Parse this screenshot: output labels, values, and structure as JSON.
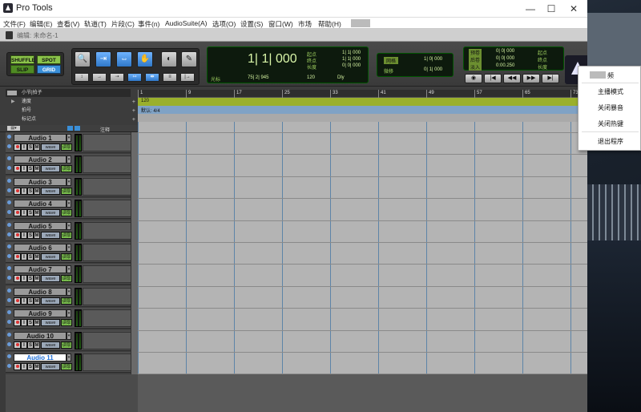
{
  "window": {
    "title": "Pro Tools",
    "minimize": "—",
    "maximize": "☐",
    "close": "✕"
  },
  "menu": [
    "文件(F)",
    "编辑(E)",
    "查看(V)",
    "轨道(T)",
    "片段(C)",
    "事件(n)",
    "AudioSuite(A)",
    "选项(O)",
    "设置(S)",
    "窗口(W)",
    "市场",
    "帮助(H)"
  ],
  "doc": {
    "title": "编辑: 未命名-1"
  },
  "modes": {
    "shuffle": "SHUFFLE",
    "spot": "SPOT",
    "slip": "SLIP",
    "grid": "GRID"
  },
  "counter": {
    "main": "1| 1| 000",
    "start_label": "起点",
    "end_label": "终点",
    "length_label": "长度",
    "start": "1| 1| 000",
    "end": "1| 1| 000",
    "length": "0| 0| 000",
    "cursor_label": "光标",
    "cursor": "75| 2| 945",
    "tempo": "120",
    "dly": "Dly"
  },
  "grid_panel": {
    "grid_label": "网格",
    "grid_val": "1| 0| 000",
    "nudge_label": "微移",
    "nudge_val": "0| 1| 000"
  },
  "transport": {
    "pre": "预卷",
    "post": "后卷",
    "fade": "淡入",
    "pre_val": "0| 0| 000",
    "post_val": "0| 0| 000",
    "fade_val": "0:00.250",
    "start_label": "起点",
    "end_label": "终点",
    "length_label": "长度",
    "rw": "◀◀",
    "ff": "▶▶",
    "stop": "◼",
    "play": "▶",
    "home": "|◀",
    "end_btn": "▶|"
  },
  "rulers": {
    "bars": "小节|拍子",
    "tempo": "速度",
    "meter": "拍号",
    "markers": "标记点",
    "tempo_value": "120",
    "meter_value": "默认: 4/4"
  },
  "timeline": [
    "1",
    "9",
    "17",
    "25",
    "33",
    "41",
    "49",
    "57",
    "65",
    "73"
  ],
  "track_header": {
    "comments": "注释"
  },
  "track_buttons": {
    "input": "I",
    "solo": "S",
    "mute": "M",
    "view": "wave",
    "auto": "读取"
  },
  "tracks": [
    "Audio 1",
    "Audio 2",
    "Audio 3",
    "Audio 4",
    "Audio 5",
    "Audio 6",
    "Audio 7",
    "Audio 8",
    "Audio 9",
    "Audio 10",
    "Audio 11"
  ],
  "context_menu": {
    "items": [
      "频",
      "主播模式",
      "关闭暴音",
      "关闭热键",
      "退出程序"
    ]
  },
  "colors": {
    "accent": "#3a8fd8",
    "mode_green": "#8bc34a",
    "tempo_ruler": "#9ab02c",
    "meter_ruler": "#7fa2c5"
  }
}
